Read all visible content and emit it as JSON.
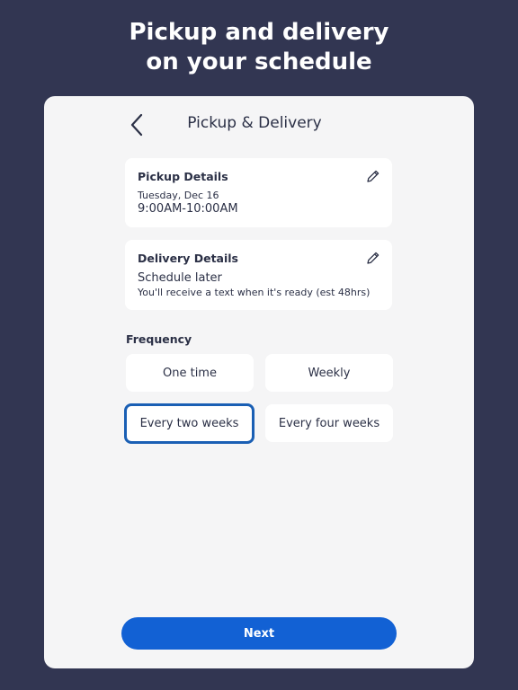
{
  "headline": {
    "line1": "Pickup and delivery",
    "line2": "on your schedule"
  },
  "nav": {
    "back_icon": "chevron-left-icon",
    "title": "Pickup & Delivery"
  },
  "pickup": {
    "title": "Pickup Details",
    "date": "Tuesday, Dec 16",
    "time": "9:00AM-10:00AM",
    "edit_icon": "pencil-icon"
  },
  "delivery": {
    "title": "Delivery Details",
    "status": "Schedule later",
    "note": "You'll receive a text when it's ready (est 48hrs)",
    "edit_icon": "pencil-icon"
  },
  "frequency": {
    "label": "Frequency",
    "options": [
      "One time",
      "Weekly",
      "Every two weeks",
      "Every four weeks"
    ],
    "selected": "Every two weeks"
  },
  "next_button": "Next",
  "colors": {
    "background": "#323652",
    "accent": "#1261d4",
    "selected_border": "#1a5fb4",
    "text": "#2b3046"
  }
}
